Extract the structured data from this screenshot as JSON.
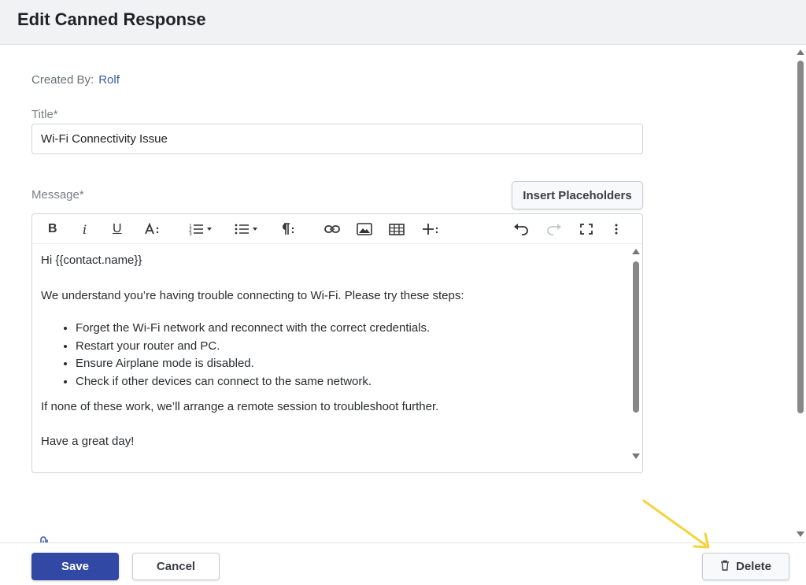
{
  "header": {
    "title": "Edit Canned Response"
  },
  "meta": {
    "created_by_label": "Created By:",
    "created_by_value": "Rolf"
  },
  "title_field": {
    "label": "Title*",
    "value": "Wi-Fi Connectivity Issue"
  },
  "message_field": {
    "label": "Message*",
    "insert_placeholders_label": "Insert Placeholders"
  },
  "toolbar": {
    "bold_label": "B",
    "italic_label": "i",
    "underline_label": "U",
    "icons": [
      "bold-icon",
      "italic-icon",
      "underline-icon",
      "text-size-icon",
      "ordered-list-icon",
      "unordered-list-icon",
      "paragraph-icon",
      "link-icon",
      "image-icon",
      "table-icon",
      "insert-more-icon",
      "undo-icon",
      "redo-icon",
      "fullscreen-icon",
      "more-vert-icon"
    ]
  },
  "message_body": {
    "greeting": "Hi {{contact.name}}",
    "intro": "We understand you’re having trouble connecting to Wi-Fi. Please try these steps:",
    "steps": [
      "Forget the Wi-Fi network and reconnect with the correct credentials.",
      "Restart your router and PC.",
      "Ensure Airplane mode is disabled.",
      "Check if other devices can connect to the same network."
    ],
    "followup": "If none of these work, we’ll arrange a remote session to troubleshoot further.",
    "closing": "Have a great day!"
  },
  "footer": {
    "save_label": "Save",
    "cancel_label": "Cancel",
    "delete_label": "Delete"
  },
  "colors": {
    "primary": "#3248a5",
    "link": "#3b5bab",
    "annotation_arrow": "#f5d33a",
    "header_bg": "#f1f2f4"
  }
}
